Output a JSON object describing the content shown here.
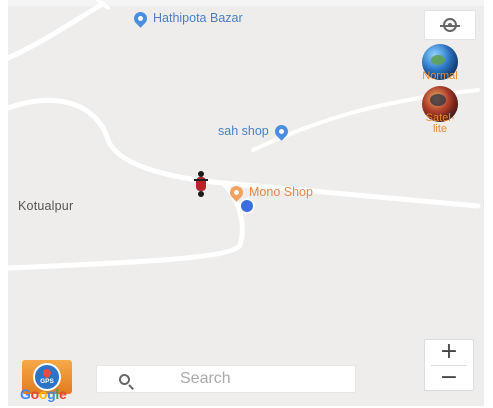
{
  "map": {
    "pois": [
      {
        "label": "Hathipota Bazar",
        "icon": "location-pin-icon",
        "color": "#4a7fc4"
      },
      {
        "label": "sah shop",
        "icon": "location-pin-icon",
        "color": "#4a7fc4"
      },
      {
        "label": "Mono Shop",
        "icon": "location-pin-icon",
        "color": "#e6894d"
      }
    ],
    "places": [
      {
        "label": "Kotualpur"
      }
    ],
    "markers": {
      "vehicle_icon": "motorbike-icon",
      "my_location_icon": "blue-dot-icon"
    }
  },
  "controls": {
    "locate_icon": "crosshair-icon",
    "layers": [
      {
        "label": "Normal",
        "icon": "globe-normal-icon"
      },
      {
        "label": "Satel-\nlite",
        "icon": "globe-satellite-icon"
      }
    ],
    "zoom_in_label": "+",
    "zoom_out_label": "−",
    "gps_label": "GPS",
    "attribution": "Google"
  },
  "search": {
    "placeholder": "Search",
    "icon": "search-icon"
  },
  "colors": {
    "map_background": "#eeedec",
    "roads": "#ffffff",
    "accent_orange": "#ef8a2d",
    "location_blue": "#3b6fe0"
  }
}
